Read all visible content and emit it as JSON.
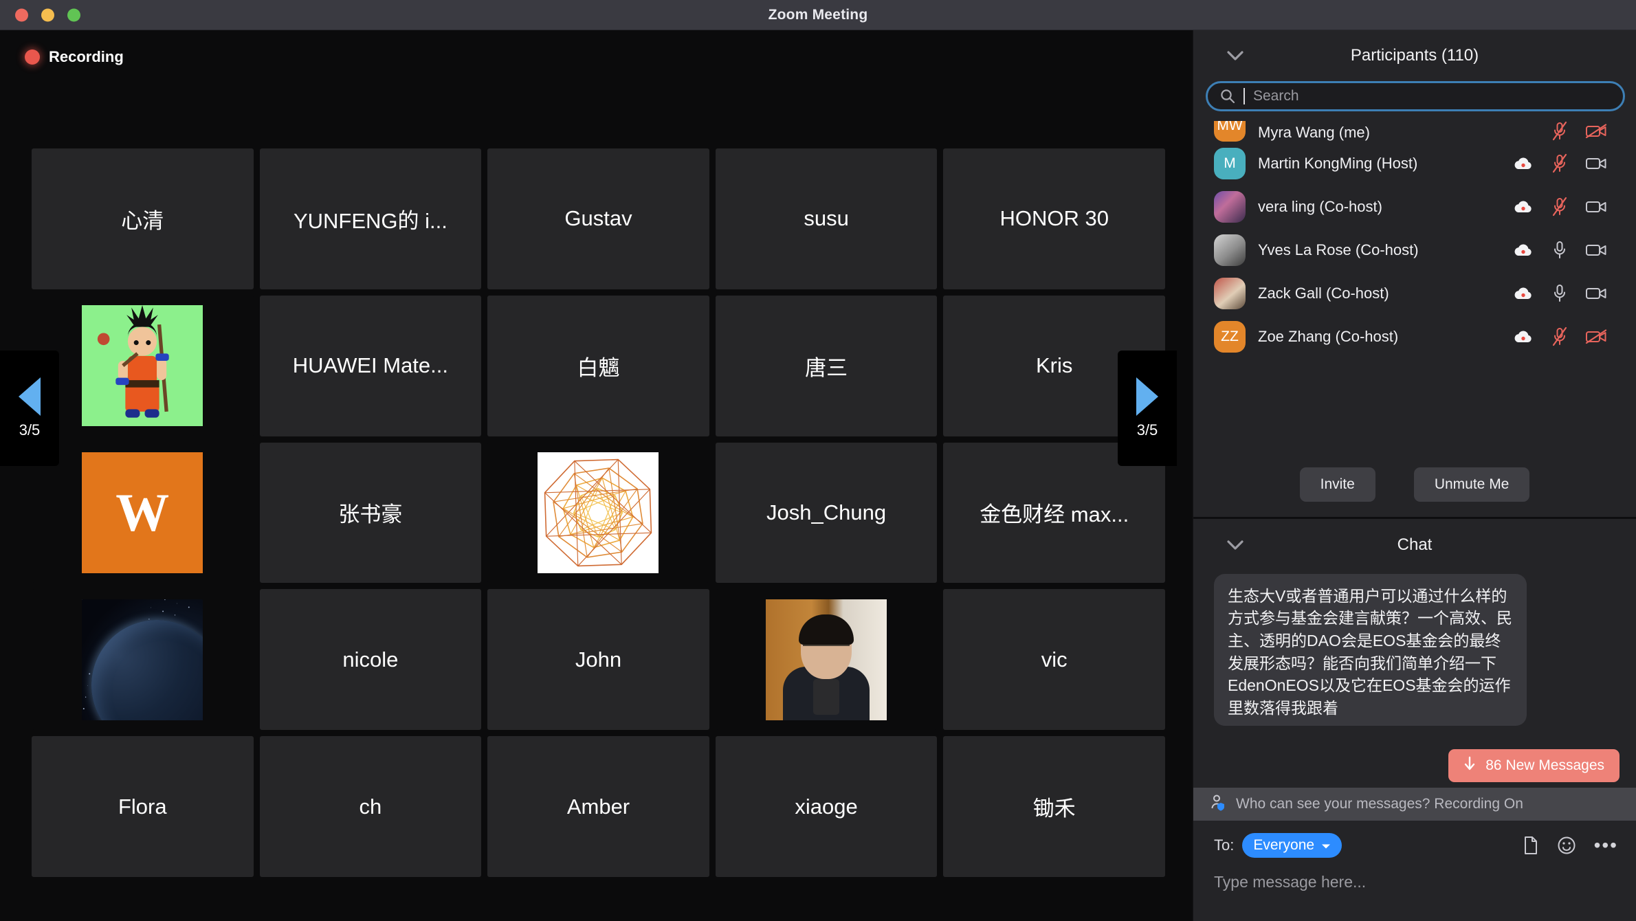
{
  "window": {
    "title": "Zoom Meeting",
    "traffic_lights": [
      "close-red",
      "minimize-yellow",
      "maximize-green"
    ]
  },
  "stage": {
    "recording_label": "Recording",
    "page_indicator": "3/5",
    "prev_page_icon": "triangle-left-icon",
    "next_page_icon": "triangle-right-icon",
    "tiles": [
      {
        "name": "心清",
        "media": "none"
      },
      {
        "name": "YUNFENG的 i...",
        "media": "none"
      },
      {
        "name": "Gustav",
        "media": "none"
      },
      {
        "name": "susu",
        "media": "none"
      },
      {
        "name": "HONOR 30",
        "media": "none"
      },
      {
        "name": "",
        "media": "goku-avatar"
      },
      {
        "name": "HUAWEI Mate...",
        "media": "none"
      },
      {
        "name": "白魑",
        "media": "none"
      },
      {
        "name": "唐三",
        "media": "none"
      },
      {
        "name": "Kris",
        "media": "none"
      },
      {
        "name": "W",
        "media": "letter-w-avatar"
      },
      {
        "name": "张书豪",
        "media": "none"
      },
      {
        "name": "",
        "media": "mandala-avatar"
      },
      {
        "name": "Josh_Chung",
        "media": "none"
      },
      {
        "name": "金色财经 max...",
        "media": "none"
      },
      {
        "name": "",
        "media": "earth-avatar"
      },
      {
        "name": "nicole",
        "media": "none"
      },
      {
        "name": "John",
        "media": "none"
      },
      {
        "name": "",
        "media": "person-video"
      },
      {
        "name": "vic",
        "media": "none"
      },
      {
        "name": "Flora",
        "media": "none"
      },
      {
        "name": "ch",
        "media": "none"
      },
      {
        "name": "Amber",
        "media": "none"
      },
      {
        "name": "xiaoge",
        "media": "none"
      },
      {
        "name": "锄禾",
        "media": "none"
      }
    ]
  },
  "participants_panel": {
    "collapse_icon": "chevron-down-icon",
    "title": "Participants (110)",
    "search": {
      "placeholder": "Search",
      "value": "",
      "icon": "search-icon"
    },
    "rows": [
      {
        "initials": "MW",
        "avatar_style": "orange",
        "name": "Myra Wang (me)",
        "recording": false,
        "mic": "muted",
        "video": "off",
        "partial": true
      },
      {
        "initials": "M",
        "avatar_style": "teal",
        "name": "Martin KongMing (Host)",
        "recording": true,
        "mic": "muted",
        "video": "on",
        "partial": false
      },
      {
        "initials": "",
        "avatar_style": "photo1",
        "name": "vera ling (Co-host)",
        "recording": true,
        "mic": "muted",
        "video": "on",
        "partial": false
      },
      {
        "initials": "",
        "avatar_style": "photo2",
        "name": "Yves La Rose (Co-host)",
        "recording": true,
        "mic": "unmuted",
        "video": "on",
        "partial": false
      },
      {
        "initials": "",
        "avatar_style": "photo3",
        "name": "Zack Gall (Co-host)",
        "recording": true,
        "mic": "unmuted",
        "video": "on",
        "partial": false
      },
      {
        "initials": "ZZ",
        "avatar_style": "orange",
        "name": "Zoe Zhang (Co-host)",
        "recording": true,
        "mic": "muted",
        "video": "off",
        "partial": false
      }
    ],
    "actions": {
      "invite": "Invite",
      "unmute_me": "Unmute Me"
    }
  },
  "chat_panel": {
    "collapse_icon": "chevron-down-icon",
    "title": "Chat",
    "message": "生态大V或者普通用户可以通过什么样的方式参与基金会建言献策？一个高效、民主、透明的DAO会是EOS基金会的最终发展形态吗？能否向我们简单介绍一下EdenOnEOS以及它在EOS基金会的运作里数落得我跟着",
    "new_messages_badge": {
      "arrow_icon": "arrow-down-icon",
      "label": "86 New Messages"
    },
    "privacy_notice": {
      "icon": "person-shield-icon",
      "text": "Who can see your messages? Recording On"
    },
    "compose": {
      "to_label": "To:",
      "to_value": "Everyone",
      "to_caret_icon": "caret-down-icon",
      "file_icon": "file-icon",
      "emoji_icon": "smiley-icon",
      "more_icon": "ellipsis-icon",
      "placeholder": "Type message here...",
      "value": ""
    }
  },
  "colors": {
    "accent_blue": "#2d8cff",
    "arrow_blue": "#62b0f0",
    "recording_red": "#e9574d",
    "badge_red": "#ee8278",
    "muted_red": "#e8645c",
    "avatar_orange": "#e3862a",
    "avatar_teal": "#49afbe",
    "panel_bg": "#242427",
    "stage_bg": "#0b0b0c",
    "tile_bg": "#262628"
  }
}
